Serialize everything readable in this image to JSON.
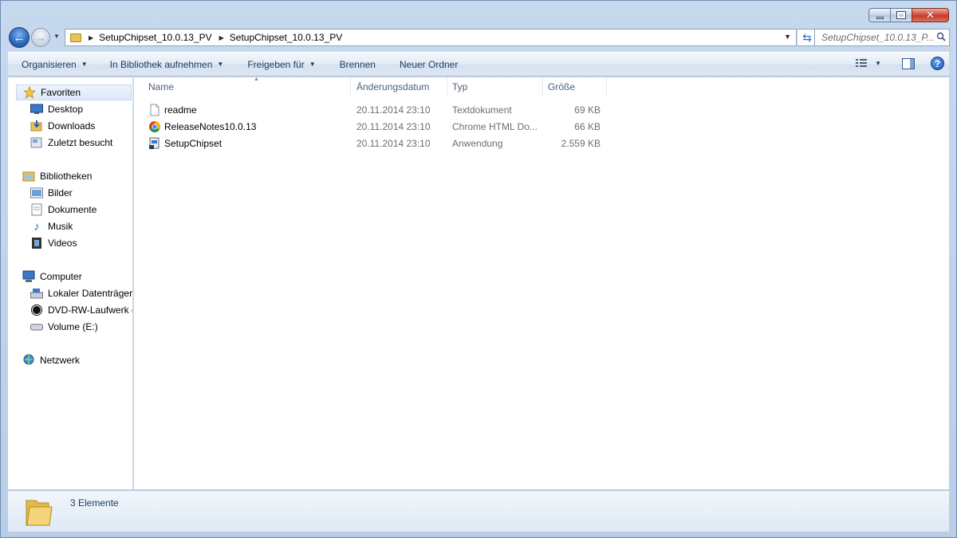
{
  "window": {
    "caption": {
      "minimize": "minimize",
      "maximize": "maximize",
      "close": "close"
    }
  },
  "navigation": {
    "back_icon": "back-arrow-icon",
    "forward_icon": "forward-arrow-icon",
    "breadcrumbs": [
      "SetupChipset_10.0.13_PV",
      "SetupChipset_10.0.13_PV"
    ],
    "search_placeholder": "SetupChipset_10.0.13_P..."
  },
  "toolbar": {
    "items": [
      {
        "label": "Organisieren",
        "dropdown": true
      },
      {
        "label": "In Bibliothek aufnehmen",
        "dropdown": true
      },
      {
        "label": "Freigeben für",
        "dropdown": true
      },
      {
        "label": "Brennen",
        "dropdown": false
      },
      {
        "label": "Neuer Ordner",
        "dropdown": false
      }
    ]
  },
  "sidebar": {
    "favorites": {
      "label": "Favoriten",
      "items": [
        "Desktop",
        "Downloads",
        "Zuletzt besucht"
      ]
    },
    "libraries": {
      "label": "Bibliotheken",
      "items": [
        "Bilder",
        "Dokumente",
        "Musik",
        "Videos"
      ]
    },
    "computer": {
      "label": "Computer",
      "items": [
        "Lokaler Datenträger",
        "DVD-RW-Laufwerk (",
        "Volume (E:)"
      ]
    },
    "network": {
      "label": "Netzwerk"
    }
  },
  "filelist": {
    "columns": [
      "Name",
      "Änderungsdatum",
      "Typ",
      "Größe"
    ],
    "rows": [
      {
        "name": "readme",
        "date": "20.11.2014 23:10",
        "type": "Textdokument",
        "size": "69 KB",
        "icon": "text-file-icon"
      },
      {
        "name": "ReleaseNotes10.0.13",
        "date": "20.11.2014 23:10",
        "type": "Chrome HTML Do...",
        "size": "66 KB",
        "icon": "chrome-icon"
      },
      {
        "name": "SetupChipset",
        "date": "20.11.2014 23:10",
        "type": "Anwendung",
        "size": "2.559 KB",
        "icon": "setup-app-icon"
      }
    ]
  },
  "status": {
    "count": "3 Elemente"
  }
}
